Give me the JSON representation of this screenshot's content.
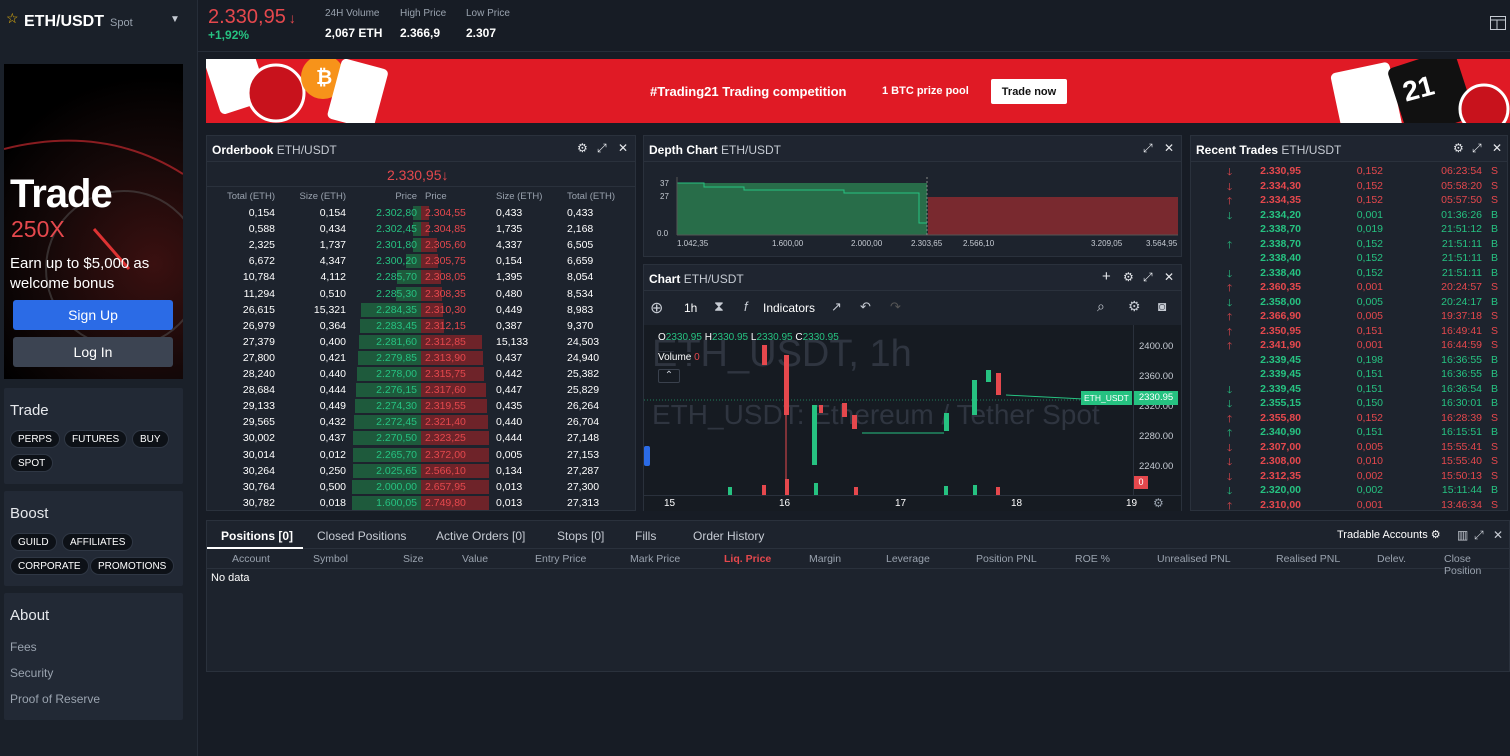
{
  "pair": {
    "symbol": "ETH/USDT",
    "type": "Spot"
  },
  "ticker": {
    "price": "2.330,95",
    "arrow": "↓",
    "change": "+1,92%",
    "stats": [
      {
        "label": "24H Volume",
        "value": "2,067 ETH"
      },
      {
        "label": "High Price",
        "value": "2.366,9"
      },
      {
        "label": "Low Price",
        "value": "2.307"
      }
    ]
  },
  "promo": {
    "big": "Trade",
    "leverage": "250X",
    "text": "Earn up to $5,000 as welcome bonus",
    "signup": "Sign Up",
    "login": "Log In"
  },
  "sidebar": {
    "trade_title": "Trade",
    "trade_chips": [
      "PERPS",
      "FUTURES",
      "BUY",
      "SPOT"
    ],
    "boost_title": "Boost",
    "boost_chips": [
      "GUILD",
      "AFFILIATES",
      "CORPORATE",
      "PROMOTIONS"
    ],
    "about_title": "About",
    "about_links": [
      "Fees",
      "Security",
      "Proof of Reserve"
    ]
  },
  "banner": {
    "title": "#Trading21 Trading competition",
    "prize": "1 BTC prize pool",
    "cta": "Trade now",
    "logo": "21"
  },
  "orderbook": {
    "title": "Orderbook",
    "pair": "ETH/USDT",
    "mid_price": "2.330,95",
    "mid_arrow": "↓",
    "headers": [
      "Total (ETH)",
      "Size (ETH)",
      "Price",
      "Price",
      "Size (ETH)",
      "Total (ETH)"
    ],
    "rows": [
      [
        "0,154",
        "0,154",
        "2.302,80",
        "2.304,55",
        "0,433",
        "0,433"
      ],
      [
        "0,588",
        "0,434",
        "2.302,45",
        "2.304,85",
        "1,735",
        "2,168"
      ],
      [
        "2,325",
        "1,737",
        "2.301,80",
        "2.305,60",
        "4,337",
        "6,505"
      ],
      [
        "6,672",
        "4,347",
        "2.300,20",
        "2.305,75",
        "0,154",
        "6,659"
      ],
      [
        "10,784",
        "4,112",
        "2.285,70",
        "2.308,05",
        "1,395",
        "8,054"
      ],
      [
        "11,294",
        "0,510",
        "2.285,30",
        "2.308,35",
        "0,480",
        "8,534"
      ],
      [
        "26,615",
        "15,321",
        "2.284,35",
        "2.310,30",
        "0,449",
        "8,983"
      ],
      [
        "26,979",
        "0,364",
        "2.283,45",
        "2.312,15",
        "0,387",
        "9,370"
      ],
      [
        "27,379",
        "0,400",
        "2.281,60",
        "2.312,85",
        "15,133",
        "24,503"
      ],
      [
        "27,800",
        "0,421",
        "2.279,85",
        "2.313,90",
        "0,437",
        "24,940"
      ],
      [
        "28,240",
        "0,440",
        "2.278,00",
        "2.315,75",
        "0,442",
        "25,382"
      ],
      [
        "28,684",
        "0,444",
        "2.276,15",
        "2.317,60",
        "0,447",
        "25,829"
      ],
      [
        "29,133",
        "0,449",
        "2.274,30",
        "2.319,55",
        "0,435",
        "26,264"
      ],
      [
        "29,565",
        "0,432",
        "2.272,45",
        "2.321,40",
        "0,440",
        "26,704"
      ],
      [
        "30,002",
        "0,437",
        "2.270,50",
        "2.323,25",
        "0,444",
        "27,148"
      ],
      [
        "30,014",
        "0,012",
        "2.265,70",
        "2.372,00",
        "0,005",
        "27,153"
      ],
      [
        "30,264",
        "0,250",
        "2.025,65",
        "2.566,10",
        "0,134",
        "27,287"
      ],
      [
        "30,764",
        "0,500",
        "2.000,00",
        "2.657,95",
        "0,013",
        "27,300"
      ],
      [
        "30,782",
        "0,018",
        "1.600,05",
        "2.749,80",
        "0,013",
        "27,313"
      ]
    ]
  },
  "depth": {
    "title": "Depth Chart",
    "pair": "ETH/USDT",
    "y_ticks": [
      "37",
      "27",
      "0.0"
    ],
    "x_ticks": [
      "1.042,35",
      "1.600,00",
      "2.000,00",
      "2.303,65",
      "2.566,10",
      "3.209,05",
      "3.564,95"
    ]
  },
  "chart": {
    "title": "Chart",
    "pair": "ETH/USDT",
    "interval": "1h",
    "indicators": "Indicators",
    "ohlc": [
      {
        "k": "O",
        "v": "2330.95"
      },
      {
        "k": "H",
        "v": "2330.95"
      },
      {
        "k": "L",
        "v": "2330.95"
      },
      {
        "k": "C",
        "v": "2330.95"
      }
    ],
    "volume_label": "Volume",
    "volume_val": "0",
    "watermark": "ETH_USDT, 1h",
    "watermark2": "ETH_USDT: Ethereum / Tether Spot",
    "price_ticks": [
      "2400.00",
      "2360.00",
      "2320.00",
      "2280.00",
      "2240.00"
    ],
    "price_tag": "2330.95",
    "symbol_tag": "ETH_USDT",
    "vol_tag": "0",
    "date_ticks": [
      "15",
      "16",
      "17",
      "18",
      "19"
    ]
  },
  "recent_trades": {
    "title": "Recent Trades",
    "pair": "ETH/USDT",
    "rows": [
      {
        "p": "2.330,95",
        "s": "0,152",
        "t": "06:23:54",
        "side": "S",
        "dir": "down"
      },
      {
        "p": "2.334,30",
        "s": "0,152",
        "t": "05:58:20",
        "side": "S",
        "dir": "down"
      },
      {
        "p": "2.334,35",
        "s": "0,152",
        "t": "05:57:50",
        "side": "S",
        "dir": "up"
      },
      {
        "p": "2.334,20",
        "s": "0,001",
        "t": "01:36:26",
        "side": "B",
        "dir": "down"
      },
      {
        "p": "2.338,70",
        "s": "0,019",
        "t": "21:51:12",
        "side": "B",
        "dir": ""
      },
      {
        "p": "2.338,70",
        "s": "0,152",
        "t": "21:51:11",
        "side": "B",
        "dir": "up"
      },
      {
        "p": "2.338,40",
        "s": "0,152",
        "t": "21:51:11",
        "side": "B",
        "dir": ""
      },
      {
        "p": "2.338,40",
        "s": "0,152",
        "t": "21:51:11",
        "side": "B",
        "dir": "down"
      },
      {
        "p": "2.360,35",
        "s": "0,001",
        "t": "20:24:57",
        "side": "S",
        "dir": "up"
      },
      {
        "p": "2.358,00",
        "s": "0,005",
        "t": "20:24:17",
        "side": "B",
        "dir": "down"
      },
      {
        "p": "2.366,90",
        "s": "0,005",
        "t": "19:37:18",
        "side": "S",
        "dir": "up"
      },
      {
        "p": "2.350,95",
        "s": "0,151",
        "t": "16:49:41",
        "side": "S",
        "dir": "up"
      },
      {
        "p": "2.341,90",
        "s": "0,001",
        "t": "16:44:59",
        "side": "S",
        "dir": "up"
      },
      {
        "p": "2.339,45",
        "s": "0,198",
        "t": "16:36:55",
        "side": "B",
        "dir": ""
      },
      {
        "p": "2.339,45",
        "s": "0,151",
        "t": "16:36:55",
        "side": "B",
        "dir": ""
      },
      {
        "p": "2.339,45",
        "s": "0,151",
        "t": "16:36:54",
        "side": "B",
        "dir": "down"
      },
      {
        "p": "2.355,15",
        "s": "0,150",
        "t": "16:30:01",
        "side": "B",
        "dir": "down"
      },
      {
        "p": "2.355,80",
        "s": "0,152",
        "t": "16:28:39",
        "side": "S",
        "dir": "up"
      },
      {
        "p": "2.340,90",
        "s": "0,151",
        "t": "16:15:51",
        "side": "B",
        "dir": "up"
      },
      {
        "p": "2.307,00",
        "s": "0,005",
        "t": "15:55:41",
        "side": "S",
        "dir": "down"
      },
      {
        "p": "2.308,00",
        "s": "0,010",
        "t": "15:55:40",
        "side": "S",
        "dir": "down"
      },
      {
        "p": "2.312,35",
        "s": "0,002",
        "t": "15:50:13",
        "side": "S",
        "dir": "down"
      },
      {
        "p": "2.320,00",
        "s": "0,002",
        "t": "15:11:44",
        "side": "B",
        "dir": "down"
      },
      {
        "p": "2.310,00",
        "s": "0,001",
        "t": "13:46:34",
        "side": "S",
        "dir": "up"
      }
    ]
  },
  "positions": {
    "tabs": [
      "Positions [0]",
      "Closed Positions",
      "Active Orders [0]",
      "Stops [0]",
      "Fills",
      "Order History"
    ],
    "tradable": "Tradable Accounts",
    "columns": [
      "Account",
      "Symbol",
      "Size",
      "Value",
      "Entry Price",
      "Mark Price",
      "Liq. Price",
      "Margin",
      "Leverage",
      "Position PNL",
      "ROE %",
      "Unrealised PNL",
      "Realised PNL",
      "Delev.",
      "Close Position"
    ],
    "empty": "No data"
  },
  "colors": {
    "green": "#26c281",
    "red": "#e5484d",
    "accent": "#2b6be6",
    "banner": "#e01a25"
  }
}
